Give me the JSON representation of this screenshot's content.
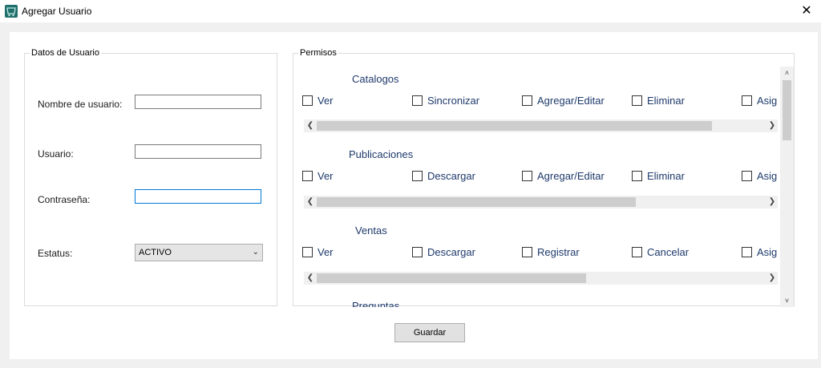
{
  "window": {
    "title": "Agregar Usuario",
    "close_glyph": "✕",
    "icon": "app-icon"
  },
  "user_group": {
    "title": "Datos de Usuario",
    "fields": {
      "nombre_label": "Nombre de usuario:",
      "nombre_value": "",
      "usuario_label": "Usuario:",
      "usuario_value": "",
      "contrasena_label": "Contraseña:",
      "contrasena_value": "",
      "estatus_label": "Estatus:",
      "estatus_value": "ACTIVO"
    }
  },
  "permisos_group": {
    "title": "Permisos",
    "sections": [
      {
        "title": "Catalogos",
        "options": [
          "Ver",
          "Sincronizar",
          "Agregar/Editar",
          "Eliminar",
          "Asig"
        ],
        "scroll_fraction": 0.88
      },
      {
        "title": "Publicaciones",
        "options": [
          "Ver",
          "Descargar",
          "Agregar/Editar",
          "Eliminar",
          "Asig"
        ],
        "scroll_fraction": 0.71
      },
      {
        "title": "Ventas",
        "options": [
          "Ver",
          "Descargar",
          "Registrar",
          "Cancelar",
          "Asig"
        ],
        "scroll_fraction": 0.6
      },
      {
        "title": "Preguntas"
      }
    ]
  },
  "actions": {
    "save_label": "Guardar"
  }
}
